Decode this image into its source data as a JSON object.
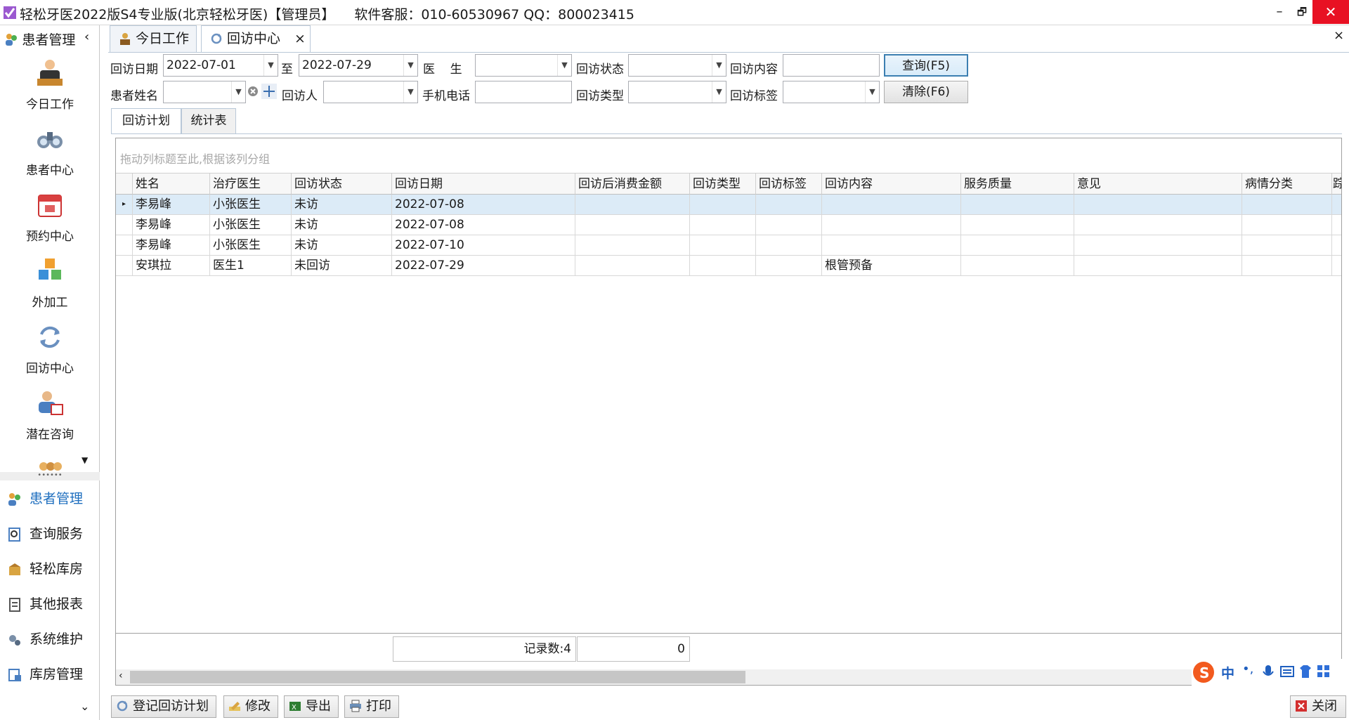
{
  "window": {
    "title": "轻松牙医2022版S4专业版(北京轻松牙医)【管理员】",
    "support": "软件客服：010-60530967 QQ：800023415"
  },
  "sidebar": {
    "header": "患者管理",
    "collapse_icon": "chevron-left-icon",
    "big_items": [
      {
        "label": "今日工作",
        "icon": "worker-icon"
      },
      {
        "label": "患者中心",
        "icon": "binoculars-icon"
      },
      {
        "label": "预约中心",
        "icon": "calendar-icon"
      },
      {
        "label": "外加工",
        "icon": "cubes-icon"
      },
      {
        "label": "回访中心",
        "icon": "refresh-icon"
      },
      {
        "label": "潜在咨询",
        "icon": "consult-icon"
      }
    ],
    "groups": [
      {
        "label": "患者管理",
        "active": true
      },
      {
        "label": "查询服务"
      },
      {
        "label": "轻松库房"
      },
      {
        "label": "其他报表"
      },
      {
        "label": "系统维护"
      },
      {
        "label": "库房管理"
      }
    ]
  },
  "tabs": [
    {
      "label": "今日工作"
    },
    {
      "label": "回访中心",
      "close": "×"
    }
  ],
  "close_all": "×",
  "filters": {
    "date_label": "回访日期",
    "date_from": "2022-07-01",
    "to_label": "至",
    "date_to": "2022-07-29",
    "doctor_label": "医    生",
    "status_label": "回访状态",
    "content_label": "回访内容",
    "query_button": "查询(F5)",
    "patient_label": "患者姓名",
    "visitor_label": "回访人",
    "phone_label": "手机电话",
    "type_label": "回访类型",
    "tag_label": "回访标签",
    "clear_button": "清除(F6)"
  },
  "subtabs": [
    "回访计划",
    "统计表"
  ],
  "grid": {
    "group_hint": "拖动列标题至此,根据该列分组",
    "columns": [
      "姓名",
      "治疗医生",
      "回访状态",
      "回访日期",
      "回访后消费金额",
      "回访类型",
      "回访标签",
      "回访内容",
      "服务质量",
      "意见",
      "病情分类",
      "踪"
    ],
    "rows": [
      [
        "李易峰",
        "小张医生",
        "未访",
        "2022-07-08",
        "",
        "",
        "",
        "",
        "",
        "",
        ""
      ],
      [
        "李易峰",
        "小张医生",
        "未访",
        "2022-07-08",
        "",
        "",
        "",
        "",
        "",
        "",
        ""
      ],
      [
        "李易峰",
        "小张医生",
        "未访",
        "2022-07-10",
        "",
        "",
        "",
        "",
        "",
        "",
        ""
      ],
      [
        "安琪拉",
        "医生1",
        "未回访",
        "2022-07-29",
        "",
        "",
        "",
        "根管预备",
        "",
        "",
        ""
      ]
    ],
    "record_count": "记录数:4",
    "amount_sum": "0"
  },
  "toolbar": {
    "register": "登记回访计划",
    "edit": "修改",
    "export": "导出",
    "print": "打印",
    "close": "关闭"
  },
  "ime": {
    "lang": "中"
  }
}
